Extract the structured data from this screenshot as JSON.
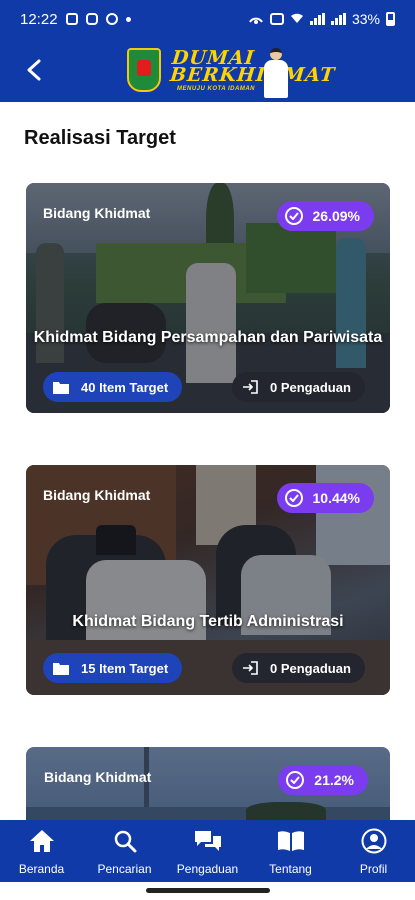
{
  "status_bar": {
    "time": "12:22",
    "battery": "33%"
  },
  "header": {
    "logo_title_line1": "DUMAI",
    "logo_title_line2": "BERKHIDMAT",
    "logo_subtitle": "MENUJU KOTA IDAMAN"
  },
  "page": {
    "title": "Realisasi Target"
  },
  "cards": [
    {
      "label": "Bidang Khidmat",
      "percent": "26.09%",
      "title": "Khidmat Bidang Persampahan dan Pariwisata",
      "targets": "40 Item Target",
      "complaints": "0 Pengaduan"
    },
    {
      "label": "Bidang Khidmat",
      "percent": "10.44%",
      "title": "Khidmat Bidang Tertib Administrasi",
      "targets": "15 Item Target",
      "complaints": "0 Pengaduan"
    },
    {
      "label": "Bidang Khidmat",
      "percent": "21.2%"
    }
  ],
  "bottom_nav": [
    {
      "label": "Beranda",
      "icon": "home-icon"
    },
    {
      "label": "Pencarian",
      "icon": "search-icon"
    },
    {
      "label": "Pengaduan",
      "icon": "chat-icon"
    },
    {
      "label": "Tentang",
      "icon": "book-icon"
    },
    {
      "label": "Profil",
      "icon": "user-icon"
    }
  ],
  "colors": {
    "primary": "#0f3aa8",
    "badge": "#7b3cf0",
    "target_pill": "#1f43b8",
    "logo_yellow": "#ffd400"
  }
}
